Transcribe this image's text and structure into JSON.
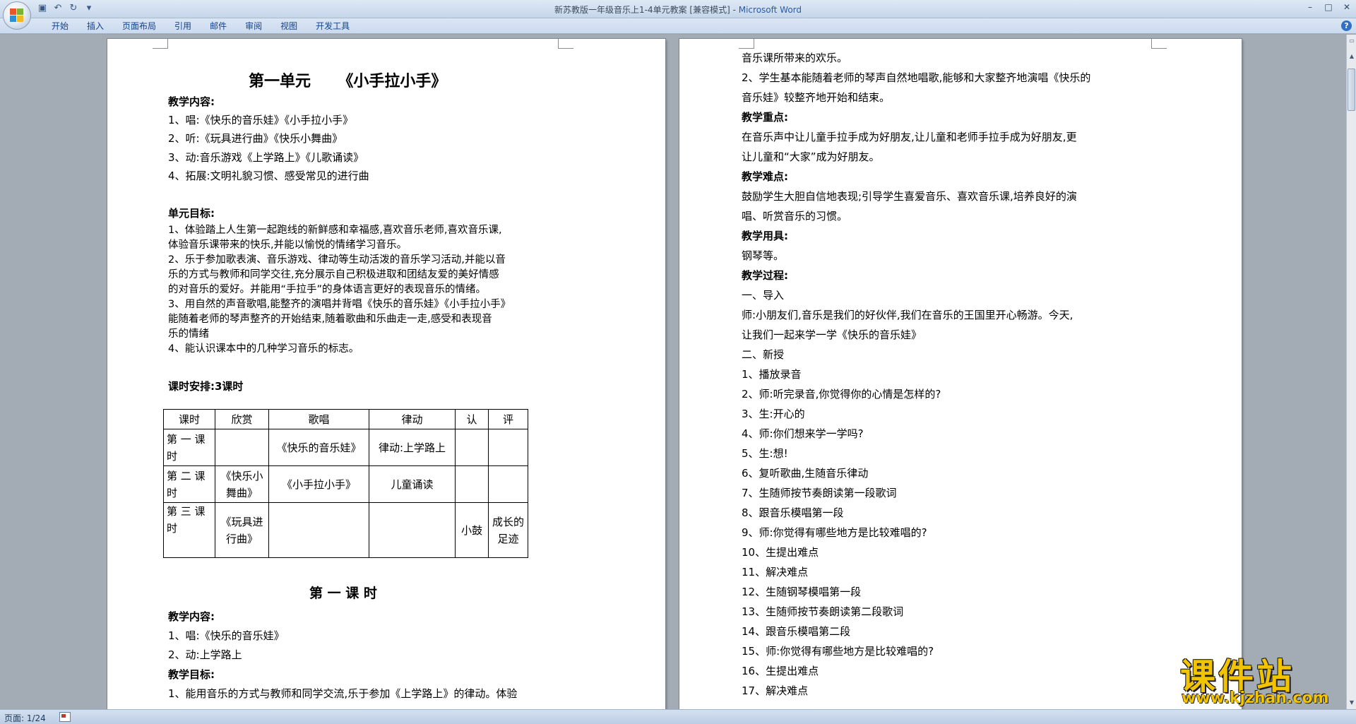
{
  "window": {
    "title": "新苏教版一年级音乐上1-4单元教案 [兼容模式] - ",
    "app_name": "Microsoft Word",
    "quick_access": [
      "save-icon",
      "undo-icon",
      "redo-icon",
      "customize-icon"
    ]
  },
  "ribbon": {
    "tabs": [
      "开始",
      "插入",
      "页面布局",
      "引用",
      "邮件",
      "审阅",
      "视图",
      "开发工具"
    ],
    "help": "?"
  },
  "page1": {
    "title_unit": "第一单元",
    "title_song": "《小手拉小手》",
    "content_heading": "教学内容:",
    "content_items": [
      "1、唱:《快乐的音乐娃》《小手拉小手》",
      "2、听:《玩具进行曲》《快乐小舞曲》",
      "3、动:音乐游戏《上学路上》《儿歌诵读》",
      "4、拓展:文明礼貌习惯、感受常见的进行曲"
    ],
    "goals_heading": "单元目标:",
    "goals_lines": [
      "1、体验踏上人生第一起跑线的新鲜感和幸福感,喜欢音乐老师,喜欢音乐课,",
      "体验音乐课带来的快乐,并能以愉悦的情绪学习音乐。",
      "2、乐于参加歌表演、音乐游戏、律动等生动活泼的音乐学习活动,并能以音",
      "乐的方式与教师和同学交往,充分展示自己积极进取和团结友爱的美好情感",
      "的对音乐的爱好。并能用“手拉手”的身体语言更好的表现音乐的情绪。",
      "3、用自然的声音歌唱,能整齐的演唱并背唱《快乐的音乐娃》《小手拉小手》",
      "能随着老师的琴声整齐的开始结束,随着歌曲和乐曲走一走,感受和表现音",
      "乐的情绪",
      "4、能认识课本中的几种学习音乐的标志。"
    ],
    "schedule": "课时安排:3课时",
    "table": {
      "headers": [
        "课时",
        "欣赏",
        "歌唱",
        "律动",
        "认",
        "评"
      ],
      "rows": [
        [
          "第 一 课 时",
          "",
          "《快乐的音乐娃》",
          "律动:上学路上",
          "",
          ""
        ],
        [
          "第 二 课 时",
          "《快乐小舞曲》",
          "《小手拉小手》",
          "儿童诵读",
          "",
          ""
        ],
        [
          "第 三 课 时",
          "《玩具进行曲》",
          "",
          "",
          "小鼓",
          "成长的足迹"
        ]
      ]
    },
    "lesson_title": "第 一 课 时",
    "lesson_content_heading": "教学内容:",
    "lesson_items": [
      "1、唱:《快乐的音乐娃》",
      "2、动:上学路上"
    ],
    "lesson_goal_heading": "教学目标:",
    "lesson_goal_line": "1、能用音乐的方式与教师和同学交流,乐于参加《上学路上》的律动。体验"
  },
  "page2": {
    "lines": [
      {
        "t": "音乐课所带来的欢乐。",
        "b": false
      },
      {
        "t": "2、学生基本能随着老师的琴声自然地唱歌,能够和大家整齐地演唱《快乐的",
        "b": false
      },
      {
        "t": "音乐娃》较整齐地开始和结束。",
        "b": false
      },
      {
        "t": "教学重点:",
        "b": true
      },
      {
        "t": "在音乐声中让儿童手拉手成为好朋友,让儿童和老师手拉手成为好朋友,更",
        "b": false
      },
      {
        "t": "让儿童和“大家”成为好朋友。",
        "b": false
      },
      {
        "t": "教学难点:",
        "b": true
      },
      {
        "t": "鼓励学生大胆自信地表现;引导学生喜爱音乐、喜欢音乐课,培养良好的演",
        "b": false
      },
      {
        "t": "唱、听赏音乐的习惯。",
        "b": false
      },
      {
        "t": "教学用具:",
        "b": true
      },
      {
        "t": "钢琴等。",
        "b": false
      },
      {
        "t": "教学过程:",
        "b": true
      },
      {
        "t": "一、导入",
        "b": false
      },
      {
        "t": "师:小朋友们,音乐是我们的好伙伴,我们在音乐的王国里开心畅游。今天,",
        "b": false
      },
      {
        "t": "让我们一起来学一学《快乐的音乐娃》",
        "b": false
      },
      {
        "t": "二、新授",
        "b": false
      },
      {
        "t": "1、播放录音",
        "b": false
      },
      {
        "t": "2、师:听完录音,你觉得你的心情是怎样的?",
        "b": false
      },
      {
        "t": "3、生:开心的",
        "b": false
      },
      {
        "t": "4、师:你们想来学一学吗?",
        "b": false
      },
      {
        "t": "5、生:想!",
        "b": false
      },
      {
        "t": "6、复听歌曲,生随音乐律动",
        "b": false
      },
      {
        "t": "7、生随师按节奏朗读第一段歌词",
        "b": false
      },
      {
        "t": "8、跟音乐模唱第一段",
        "b": false
      },
      {
        "t": "9、师:你觉得有哪些地方是比较难唱的?",
        "b": false
      },
      {
        "t": "10、生提出难点",
        "b": false
      },
      {
        "t": "11、解决难点",
        "b": false
      },
      {
        "t": "12、生随钢琴模唱第一段",
        "b": false
      },
      {
        "t": "13、生随师按节奏朗读第二段歌词",
        "b": false
      },
      {
        "t": "14、跟音乐模唱第二段",
        "b": false
      },
      {
        "t": "15、师:你觉得有哪些地方是比较难唱的?",
        "b": false
      },
      {
        "t": "16、生提出难点",
        "b": false
      },
      {
        "t": "17、解决难点",
        "b": false
      }
    ]
  },
  "status": {
    "page_info": "页面: 1/24"
  },
  "watermark": {
    "big": "课件站",
    "small": "www.kjzhan.com"
  },
  "colors": {
    "title_bar": "#c5d6ea",
    "app_name": "#2a5aa8",
    "watermark": "#f2c400",
    "workspace": "#a3abb5"
  }
}
